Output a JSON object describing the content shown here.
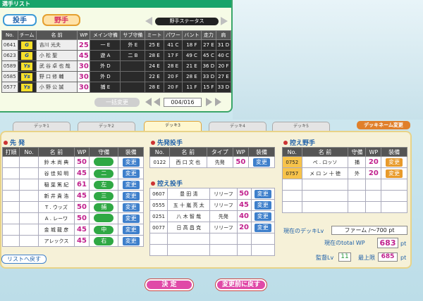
{
  "header": {
    "title": "選手リスト"
  },
  "toggles": {
    "pitcher": "投手",
    "fielder": "野手"
  },
  "sort": {
    "label": "野手ステータス"
  },
  "players": {
    "columns": [
      "No.",
      "チーム",
      "名 前",
      "WP",
      "メイン守備",
      "サブ守備",
      "ミート",
      "パワー",
      "バント",
      "走力",
      "肩"
    ],
    "rows": [
      {
        "no": "0641",
        "team": "G",
        "name": "吉川 光夫",
        "wp": "25",
        "main": "一 E",
        "sub": "外 E",
        "meet": "25 E",
        "power": "41 C",
        "bunt": "18 F",
        "speed": "27 E",
        "arm": "31 D"
      },
      {
        "no": "0623",
        "team": "G",
        "name": "小 松 聖",
        "wp": "45",
        "main": "遊 A",
        "sub": "二 B",
        "meet": "28 E",
        "power": "17 F",
        "bunt": "49 C",
        "speed": "45 C",
        "arm": "40 C"
      },
      {
        "no": "0589",
        "team": "Ys",
        "name": "武 谷 卓 也 哉",
        "wp": "30",
        "main": "外 D",
        "sub": "",
        "meet": "24 E",
        "power": "28 E",
        "bunt": "21 E",
        "speed": "36 D",
        "arm": "20 F"
      },
      {
        "no": "0585",
        "team": "Ys",
        "name": "野 口 修 輔",
        "wp": "30",
        "main": "外 D",
        "sub": "",
        "meet": "22 E",
        "power": "20 F",
        "bunt": "28 E",
        "speed": "33 D",
        "arm": "27 E"
      },
      {
        "no": "0577",
        "team": "Ys",
        "name": "小 野 公 誠",
        "wp": "30",
        "main": "捕 E",
        "sub": "",
        "meet": "28 E",
        "power": "20 F",
        "bunt": "11 F",
        "speed": "15 F",
        "arm": "33 D"
      }
    ]
  },
  "pager": {
    "batch_label": "一括変更",
    "counter": "004/016"
  },
  "tabs": [
    "デッキ1",
    "デッキ2",
    "デッキ3",
    "デッキ4",
    "デッキ5"
  ],
  "deck_name_btn": "デッキネーム変更",
  "starting": {
    "title": "先 発",
    "columns": [
      "打順",
      "No.",
      "名 前",
      "WP",
      "守備",
      "装備"
    ],
    "rows": [
      {
        "order": "1",
        "no": "0537",
        "name": "鈴 木 尚 典",
        "wp": "50",
        "pos": "",
        "equip": "変更"
      },
      {
        "order": "2",
        "no": "0205",
        "name": "谷 佳 知 明",
        "wp": "45",
        "pos": "二",
        "equip": "変更"
      },
      {
        "order": "3",
        "no": "0443",
        "name": "稲 葉 篤 紀",
        "wp": "61",
        "pos": "左",
        "equip": "変更"
      },
      {
        "order": "4",
        "no": "0690",
        "name": "新 井 貴 浩",
        "wp": "45",
        "pos": "三",
        "equip": "変更"
      },
      {
        "order": "5",
        "no": "0480",
        "name": "T . ウッズ",
        "wp": "50",
        "pos": "捕",
        "equip": "変更"
      },
      {
        "order": "6",
        "no": "0386",
        "name": "A . レーワ",
        "wp": "50",
        "pos": "",
        "equip": "変更"
      },
      {
        "order": "7",
        "no": "0503",
        "name": "金 城 龍 彦",
        "wp": "45",
        "pos": "中",
        "equip": "変更"
      },
      {
        "order": "8",
        "no": "0446",
        "name": "アレックス",
        "wp": "45",
        "pos": "右",
        "equip": "変更"
      }
    ]
  },
  "starting_pitcher": {
    "title": "先発投手",
    "columns": [
      "No.",
      "名 前",
      "タイプ",
      "WP",
      "装備"
    ],
    "rows": [
      {
        "no": "0122",
        "name": "西 口 文 也",
        "type": "先発",
        "wp": "50",
        "equip": "変更"
      }
    ]
  },
  "relief": {
    "title": "控え投手",
    "rows": [
      {
        "no": "0607",
        "name": "豊 田 清",
        "type": "リリーフ",
        "wp": "50",
        "equip": "変更"
      },
      {
        "no": "0555",
        "name": "五 十 嵐 亮 太",
        "type": "リリーフ",
        "wp": "45",
        "equip": "変更"
      },
      {
        "no": "0251",
        "name": "八 木 智 哉",
        "type": "先発",
        "wp": "40",
        "equip": "変更"
      },
      {
        "no": "0077",
        "name": "日 高 昌 克",
        "type": "リリーフ",
        "wp": "20",
        "equip": "変更"
      }
    ]
  },
  "bench": {
    "title": "控え野手",
    "columns": [
      "No.",
      "名 前",
      "守備",
      "WP",
      "装備"
    ],
    "rows": [
      {
        "no": "0752",
        "name": "ぺ . ロッソ",
        "pos": "捕",
        "wp": "20",
        "equip": "変更"
      },
      {
        "no": "0757",
        "name": "メ ロ ン 十 徳",
        "pos": "外",
        "wp": "20",
        "equip": "変更"
      }
    ]
  },
  "status": {
    "deck_lv_label": "現在のデッキLv",
    "deck_lv_value": "ファーム /～700 pt",
    "total_wp_label": "現在のtotal WP",
    "total_wp_value": "683",
    "pt": "pt",
    "manager_label": "監督Lv",
    "manager_value": "11",
    "max_label": "最上限",
    "max_value": "685"
  },
  "back_list": "リストへ戻す",
  "decide": "決 定",
  "revert": "変更前に戻す"
}
